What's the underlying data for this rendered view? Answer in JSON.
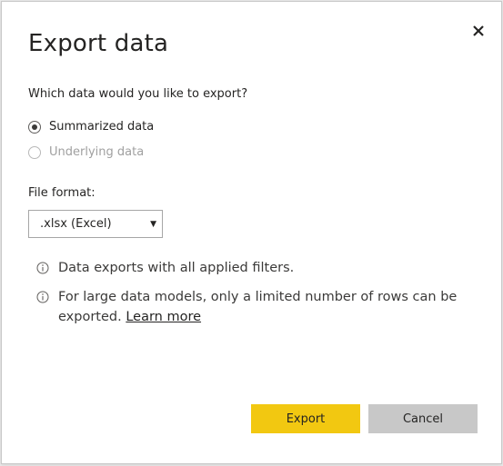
{
  "dialog": {
    "title": "Export data",
    "question": "Which data would you like to export?",
    "options": [
      {
        "label": "Summarized data",
        "selected": true,
        "enabled": true
      },
      {
        "label": "Underlying data",
        "selected": false,
        "enabled": false
      }
    ],
    "file_format_label": "File format:",
    "file_format_value": ".xlsx (Excel)",
    "info_filters": "Data exports with all applied filters.",
    "info_rows": "For large data models, only a limited number of rows can be exported.",
    "learn_more": "Learn more",
    "export_label": "Export",
    "cancel_label": "Cancel",
    "close_icon": "close-icon"
  },
  "colors": {
    "primary_button": "#f2c811",
    "secondary_button": "#c8c8c8",
    "text": "#252423"
  }
}
